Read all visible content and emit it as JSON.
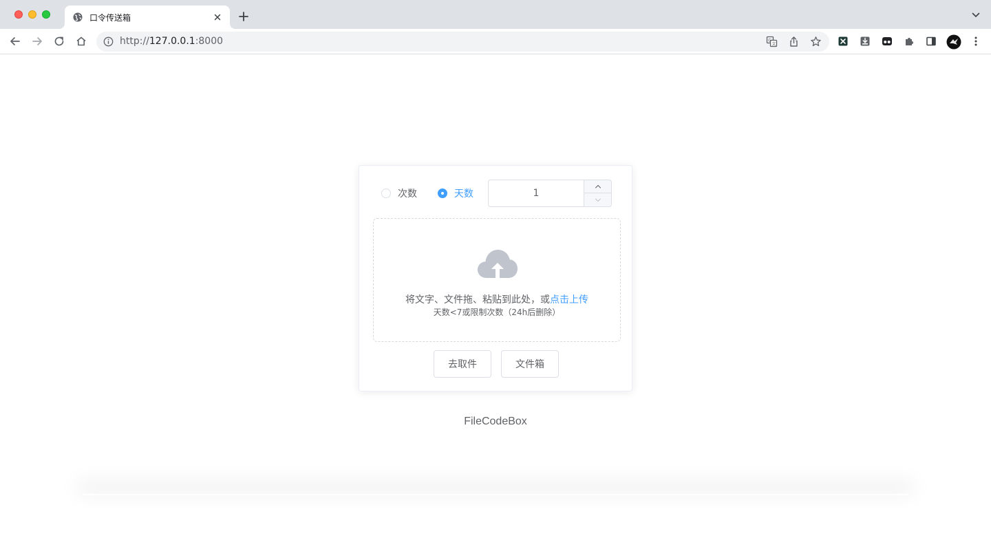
{
  "browser": {
    "tab_title": "口令传送箱",
    "url_scheme": "http://",
    "url_host": "127.0.0.1",
    "url_port": ":8000"
  },
  "form": {
    "radio_count_label": "次数",
    "radio_days_label": "天数",
    "selected": "days",
    "number_value": "1"
  },
  "upload": {
    "text": "将文字、文件拖、粘贴到此处，或",
    "link": "点击上传",
    "tip": "天数<7或限制次数（24h后删除）"
  },
  "buttons": {
    "get_label": "去取件",
    "box_label": "文件箱"
  },
  "footer": {
    "brand": "FileCodeBox"
  },
  "colors": {
    "accent": "#409eff",
    "text": "#606266",
    "border": "#dcdfe6",
    "icon_gray": "#c0c4cc"
  }
}
